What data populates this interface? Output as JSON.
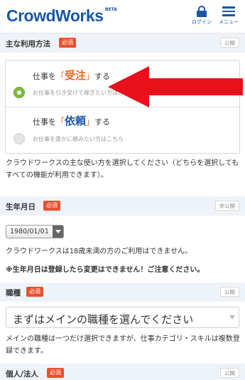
{
  "header": {
    "logo": "CrowdWorks",
    "beta": "BETA",
    "login_label": "ログイン",
    "menu_label": "メニュー"
  },
  "usage": {
    "title": "主な利用方法",
    "required": "必須",
    "visibility": "公開",
    "option_order": {
      "prefix": "仕事を",
      "open_q": "「",
      "keyword": "受注",
      "close_q": "」",
      "suffix": "する",
      "sub": "お仕事を引き受けて稼ぎたい方はこちら",
      "selected": true
    },
    "option_request": {
      "prefix": "仕事を",
      "open_q": "「",
      "keyword": "依頼",
      "close_q": "」",
      "suffix": "する",
      "sub": "お仕事を誰かに頼みたい方はこちら",
      "selected": false
    },
    "help": "クラウドワークスの主な使い方を選択してください（どちらを選択してもすべての機能が利用できます）。"
  },
  "birthdate": {
    "title": "生年月日",
    "required": "必須",
    "visibility": "非公開",
    "value": "1980/01/01",
    "help": "クラウドワークスは18歳未満の方のご利用はできません。",
    "warning": "※生年月日は登録したら変更はできません！ご注意ください。"
  },
  "job": {
    "title": "職種",
    "required": "必須",
    "visibility": "公開",
    "placeholder": "まずはメインの職種を選んでください",
    "help": "メインの職種は一つだけ選択できますが、仕事カテゴリ・スキルは複数登録できます。"
  },
  "entity": {
    "title": "個人/法人",
    "required": "必須",
    "visibility": "公開"
  },
  "colors": {
    "brand": "#1a56a6",
    "required_badge": "#e8512d",
    "highlight": "#f0671f",
    "radio_on": "#7dbd3a",
    "annotation_arrow": "#e8101a"
  }
}
